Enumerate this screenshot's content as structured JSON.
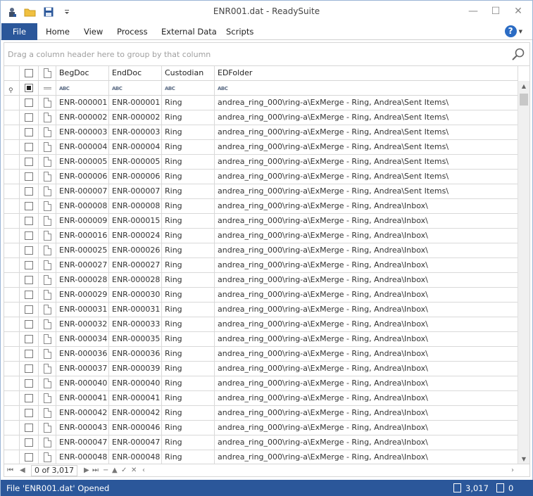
{
  "window": {
    "title": "ENR001.dat - ReadySuite"
  },
  "qat": {
    "icons": [
      "app-icon",
      "open-folder-icon",
      "save-icon",
      "customize-dropdown-icon"
    ]
  },
  "ribbon": {
    "tabs": [
      {
        "label": "File"
      },
      {
        "label": "Home"
      },
      {
        "label": "View"
      },
      {
        "label": "Process"
      },
      {
        "label": "External Data"
      },
      {
        "label": "Scripts"
      }
    ],
    "help_label": "?"
  },
  "group_panel": {
    "hint": "Drag a column header here to group by that column"
  },
  "grid": {
    "columns": [
      "BegDoc",
      "EndDoc",
      "Custodian",
      "EDFolder"
    ],
    "filter_type_label": "ABC",
    "rows": [
      [
        "ENR-000001",
        "ENR-000001",
        "Ring",
        "andrea_ring_000\\ring-a\\ExMerge - Ring, Andrea\\Sent Items\\"
      ],
      [
        "ENR-000002",
        "ENR-000002",
        "Ring",
        "andrea_ring_000\\ring-a\\ExMerge - Ring, Andrea\\Sent Items\\"
      ],
      [
        "ENR-000003",
        "ENR-000003",
        "Ring",
        "andrea_ring_000\\ring-a\\ExMerge - Ring, Andrea\\Sent Items\\"
      ],
      [
        "ENR-000004",
        "ENR-000004",
        "Ring",
        "andrea_ring_000\\ring-a\\ExMerge - Ring, Andrea\\Sent Items\\"
      ],
      [
        "ENR-000005",
        "ENR-000005",
        "Ring",
        "andrea_ring_000\\ring-a\\ExMerge - Ring, Andrea\\Sent Items\\"
      ],
      [
        "ENR-000006",
        "ENR-000006",
        "Ring",
        "andrea_ring_000\\ring-a\\ExMerge - Ring, Andrea\\Sent Items\\"
      ],
      [
        "ENR-000007",
        "ENR-000007",
        "Ring",
        "andrea_ring_000\\ring-a\\ExMerge - Ring, Andrea\\Sent Items\\"
      ],
      [
        "ENR-000008",
        "ENR-000008",
        "Ring",
        "andrea_ring_000\\ring-a\\ExMerge - Ring, Andrea\\Inbox\\"
      ],
      [
        "ENR-000009",
        "ENR-000015",
        "Ring",
        "andrea_ring_000\\ring-a\\ExMerge - Ring, Andrea\\Inbox\\"
      ],
      [
        "ENR-000016",
        "ENR-000024",
        "Ring",
        "andrea_ring_000\\ring-a\\ExMerge - Ring, Andrea\\Inbox\\"
      ],
      [
        "ENR-000025",
        "ENR-000026",
        "Ring",
        "andrea_ring_000\\ring-a\\ExMerge - Ring, Andrea\\Inbox\\"
      ],
      [
        "ENR-000027",
        "ENR-000027",
        "Ring",
        "andrea_ring_000\\ring-a\\ExMerge - Ring, Andrea\\Inbox\\"
      ],
      [
        "ENR-000028",
        "ENR-000028",
        "Ring",
        "andrea_ring_000\\ring-a\\ExMerge - Ring, Andrea\\Inbox\\"
      ],
      [
        "ENR-000029",
        "ENR-000030",
        "Ring",
        "andrea_ring_000\\ring-a\\ExMerge - Ring, Andrea\\Inbox\\"
      ],
      [
        "ENR-000031",
        "ENR-000031",
        "Ring",
        "andrea_ring_000\\ring-a\\ExMerge - Ring, Andrea\\Inbox\\"
      ],
      [
        "ENR-000032",
        "ENR-000033",
        "Ring",
        "andrea_ring_000\\ring-a\\ExMerge - Ring, Andrea\\Inbox\\"
      ],
      [
        "ENR-000034",
        "ENR-000035",
        "Ring",
        "andrea_ring_000\\ring-a\\ExMerge - Ring, Andrea\\Inbox\\"
      ],
      [
        "ENR-000036",
        "ENR-000036",
        "Ring",
        "andrea_ring_000\\ring-a\\ExMerge - Ring, Andrea\\Inbox\\"
      ],
      [
        "ENR-000037",
        "ENR-000039",
        "Ring",
        "andrea_ring_000\\ring-a\\ExMerge - Ring, Andrea\\Inbox\\"
      ],
      [
        "ENR-000040",
        "ENR-000040",
        "Ring",
        "andrea_ring_000\\ring-a\\ExMerge - Ring, Andrea\\Inbox\\"
      ],
      [
        "ENR-000041",
        "ENR-000041",
        "Ring",
        "andrea_ring_000\\ring-a\\ExMerge - Ring, Andrea\\Inbox\\"
      ],
      [
        "ENR-000042",
        "ENR-000042",
        "Ring",
        "andrea_ring_000\\ring-a\\ExMerge - Ring, Andrea\\Inbox\\"
      ],
      [
        "ENR-000043",
        "ENR-000046",
        "Ring",
        "andrea_ring_000\\ring-a\\ExMerge - Ring, Andrea\\Inbox\\"
      ],
      [
        "ENR-000047",
        "ENR-000047",
        "Ring",
        "andrea_ring_000\\ring-a\\ExMerge - Ring, Andrea\\Inbox\\"
      ],
      [
        "ENR-000048",
        "ENR-000048",
        "Ring",
        "andrea_ring_000\\ring-a\\ExMerge - Ring, Andrea\\Inbox\\"
      ]
    ]
  },
  "navigator": {
    "position": "0 of 3,017"
  },
  "status": {
    "message": "File 'ENR001.dat' Opened",
    "record_count": "3,017",
    "selected_count": "0"
  },
  "colors": {
    "accent": "#2b579a",
    "status_bar": "#2b579a"
  }
}
